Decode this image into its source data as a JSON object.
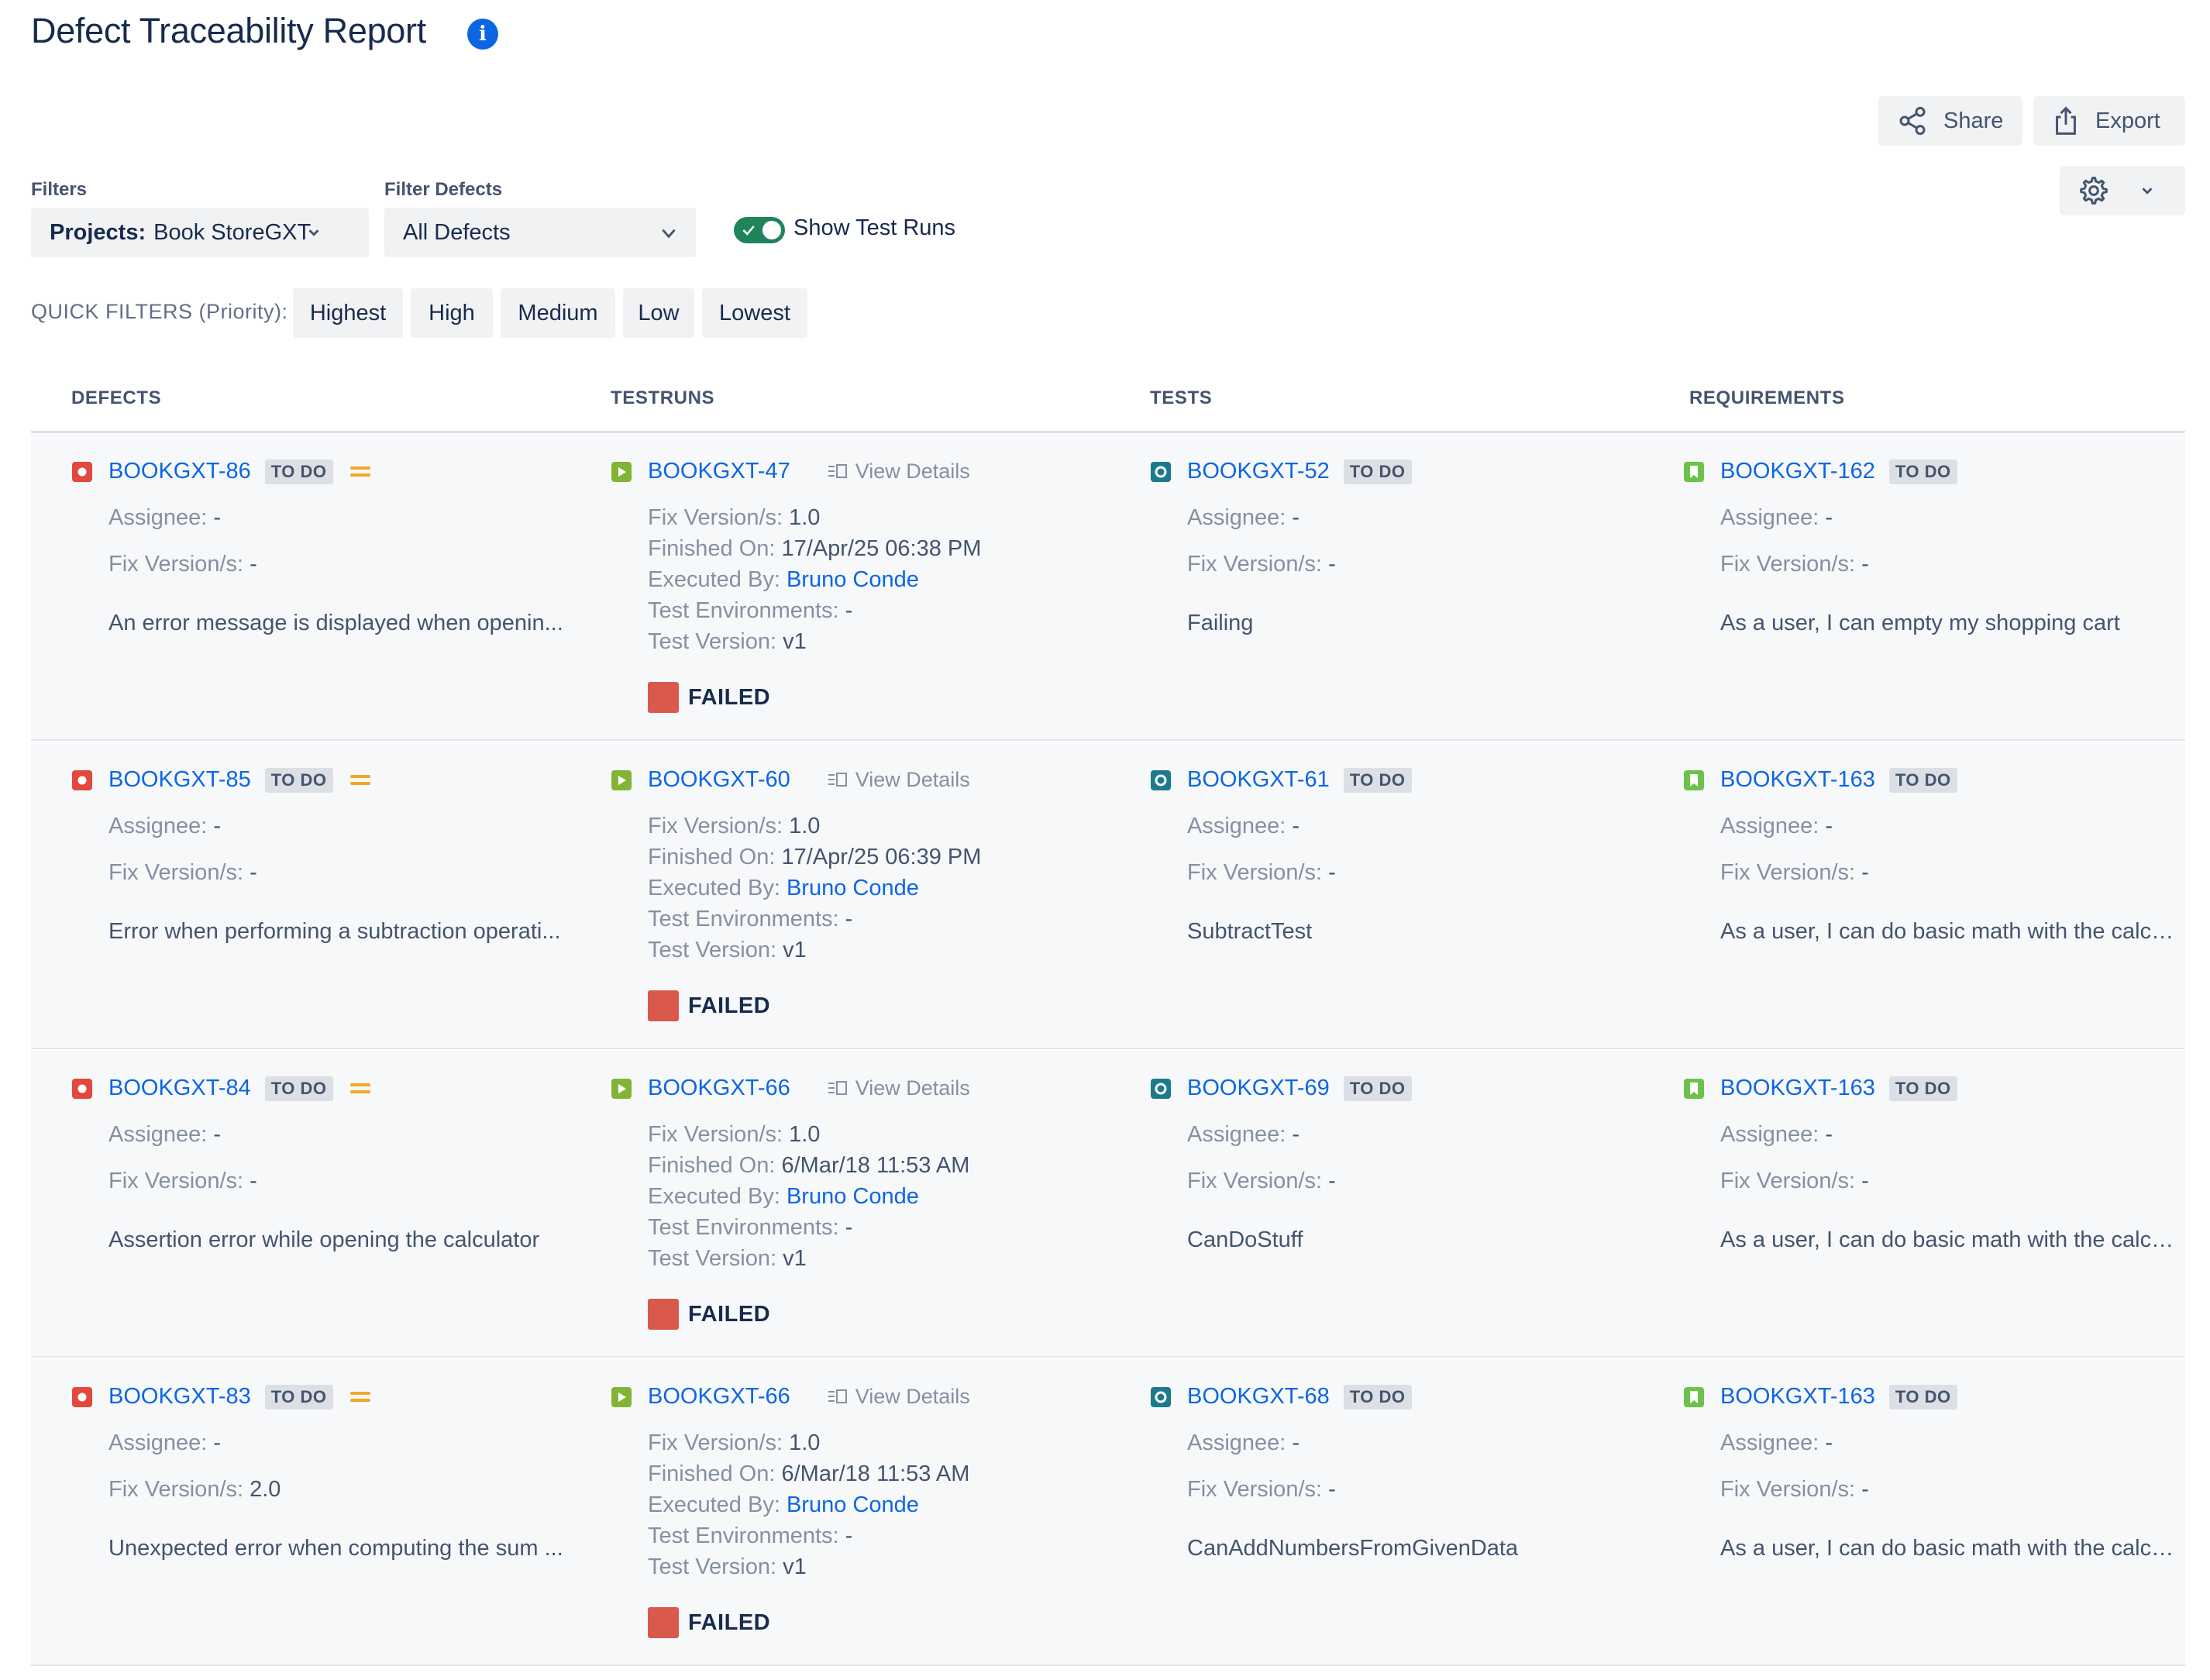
{
  "header": {
    "title": "Defect Traceability Report"
  },
  "actions": {
    "share_label": "Share",
    "export_label": "Export"
  },
  "filters": {
    "filters_label": "Filters",
    "projects_key": "Projects:",
    "projects_value": "Book StoreGXT",
    "filter_defects_label": "Filter Defects",
    "filter_defects_value": "All Defects",
    "show_test_runs_label": "Show Test Runs",
    "show_test_runs_enabled": true
  },
  "quick_filters": {
    "label": "QUICK FILTERS (Priority):",
    "chips": [
      "Highest",
      "High",
      "Medium",
      "Low",
      "Lowest"
    ]
  },
  "columns": [
    "DEFECTS",
    "TESTRUNS",
    "TESTS",
    "REQUIREMENTS"
  ],
  "labels": {
    "assignee": "Assignee:",
    "fix_versions": "Fix Version/s:",
    "finished_on": "Finished On:",
    "executed_by": "Executed By:",
    "test_environments": "Test Environments:",
    "test_version": "Test Version:",
    "view_details": "View Details"
  },
  "colors": {
    "link": "#0c66e4",
    "defect_icon": "#e2483d",
    "testrun_icon": "#82b536",
    "test_icon": "#1d7a8c",
    "requirement_icon": "#6cc24a",
    "failed": "#d9594c",
    "priority_medium": "#f5a623",
    "toggle_on": "#1f845a"
  },
  "rows": [
    {
      "defect": {
        "key": "BOOKGXT-86",
        "status": "TO DO",
        "priority_icon": "medium-priority-icon",
        "assignee": "-",
        "fix_versions": "-",
        "summary": "An error message is displayed when openin..."
      },
      "testrun": {
        "key": "BOOKGXT-47",
        "fix_versions": "1.0",
        "finished_on": "17/Apr/25 06:38 PM",
        "executed_by": "Bruno Conde",
        "test_environments": "-",
        "test_version": "v1",
        "status": "FAILED"
      },
      "test": {
        "key": "BOOKGXT-52",
        "status": "TO DO",
        "assignee": "-",
        "fix_versions": "-",
        "summary": "Failing"
      },
      "requirement": {
        "key": "BOOKGXT-162",
        "status": "TO DO",
        "assignee": "-",
        "fix_versions": "-",
        "summary": "As a user, I can empty my shopping cart"
      }
    },
    {
      "defect": {
        "key": "BOOKGXT-85",
        "status": "TO DO",
        "priority_icon": "medium-priority-icon",
        "assignee": "-",
        "fix_versions": "-",
        "summary": "Error when performing a subtraction operati..."
      },
      "testrun": {
        "key": "BOOKGXT-60",
        "fix_versions": "1.0",
        "finished_on": "17/Apr/25 06:39 PM",
        "executed_by": "Bruno Conde",
        "test_environments": "-",
        "test_version": "v1",
        "status": "FAILED"
      },
      "test": {
        "key": "BOOKGXT-61",
        "status": "TO DO",
        "assignee": "-",
        "fix_versions": "-",
        "summary": "SubtractTest"
      },
      "requirement": {
        "key": "BOOKGXT-163",
        "status": "TO DO",
        "assignee": "-",
        "fix_versions": "-",
        "summary": "As a user, I can do basic math with the calcul..."
      }
    },
    {
      "defect": {
        "key": "BOOKGXT-84",
        "status": "TO DO",
        "priority_icon": "medium-priority-icon",
        "assignee": "-",
        "fix_versions": "-",
        "summary": "Assertion error while opening the calculator"
      },
      "testrun": {
        "key": "BOOKGXT-66",
        "fix_versions": "1.0",
        "finished_on": "6/Mar/18 11:53 AM",
        "executed_by": "Bruno Conde",
        "test_environments": "-",
        "test_version": "v1",
        "status": "FAILED"
      },
      "test": {
        "key": "BOOKGXT-69",
        "status": "TO DO",
        "assignee": "-",
        "fix_versions": "-",
        "summary": "CanDoStuff"
      },
      "requirement": {
        "key": "BOOKGXT-163",
        "status": "TO DO",
        "assignee": "-",
        "fix_versions": "-",
        "summary": "As a user, I can do basic math with the calcul..."
      }
    },
    {
      "defect": {
        "key": "BOOKGXT-83",
        "status": "TO DO",
        "priority_icon": "medium-priority-icon",
        "assignee": "-",
        "fix_versions": "2.0",
        "summary": "Unexpected error when computing the sum ..."
      },
      "testrun": {
        "key": "BOOKGXT-66",
        "fix_versions": "1.0",
        "finished_on": "6/Mar/18 11:53 AM",
        "executed_by": "Bruno Conde",
        "test_environments": "-",
        "test_version": "v1",
        "status": "FAILED"
      },
      "test": {
        "key": "BOOKGXT-68",
        "status": "TO DO",
        "assignee": "-",
        "fix_versions": "-",
        "summary": "CanAddNumbersFromGivenData"
      },
      "requirement": {
        "key": "BOOKGXT-163",
        "status": "TO DO",
        "assignee": "-",
        "fix_versions": "-",
        "summary": "As a user, I can do basic math with the calcul..."
      }
    }
  ]
}
